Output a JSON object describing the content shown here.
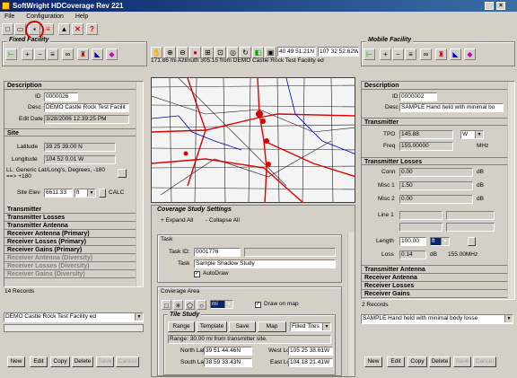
{
  "window": {
    "title": "SoftWright HDCoverage Rev 221"
  },
  "menu": [
    "File",
    "Configuration",
    "Help"
  ],
  "fixed": {
    "group_label": "Fixed Facility",
    "description_head": "Description",
    "id_label": "ID",
    "id_value": "0000026",
    "desc_label": "Desc",
    "desc_value": "DEMO Castle Rock Test Facilit",
    "edit_label": "Edit Date",
    "edit_value": "3/28/2006 12:39:25 PM",
    "site_head": "Site",
    "lat_label": "Latitude",
    "lat_value": "39 25 39.00 N",
    "lon_label": "Longitude",
    "lon_value": "104 52 0.01 W",
    "ll_note": "LL: Generic Lat/Long's, Degrees, -180 ==> +180",
    "elev_label": "Site Elev",
    "elev_value": "6611.33",
    "elev_unit": "ft",
    "calc": "CALC",
    "sections": [
      {
        "label": "Transmitter",
        "dim": false
      },
      {
        "label": "Transmitter Losses",
        "dim": false
      },
      {
        "label": "Transmitter Antenna",
        "dim": false
      },
      {
        "label": "Receiver Antenna (Primary)",
        "dim": false
      },
      {
        "label": "Receiver Losses (Primary)",
        "dim": false
      },
      {
        "label": "Receiver Gains (Primary)",
        "dim": false
      },
      {
        "label": "Receiver Antenna (Diversity)",
        "dim": true
      },
      {
        "label": "Receiver Losses (Diversity)",
        "dim": true
      },
      {
        "label": "Receiver Gains (Diversity)",
        "dim": true
      }
    ],
    "records": "14 Records",
    "select_value": "DEMO Castle Rock Test Facility ed",
    "buttons": [
      "New",
      "Edit",
      "Copy",
      "Delete",
      "Save",
      "Cancel"
    ]
  },
  "map": {
    "coord_lat": "40 49 51.21N",
    "coord_lon": "107 32 52.62W",
    "status": "171.86 mi Azimuth 305.15 from DEMO Castle Rock Test Facility ed"
  },
  "study": {
    "title": "Coverage Study Settings",
    "expand": "+ Expand All",
    "collapse": "- Collapse All",
    "task_head": "Task",
    "task_id_label": "Task ID:",
    "task_id_value": "0001776",
    "task_label": "Task",
    "task_value": "Sample Shadow Study",
    "autodraw": "AutoDraw",
    "area_head": "Coverage Area",
    "area_unit": "mi",
    "draw_on_map": "Draw on map",
    "tile_head": "Tile Study",
    "tile_buttons": [
      "Range",
      "Template",
      "Save",
      "Map"
    ],
    "tile_select": "Filled Tiles",
    "range_text": "Range: 30.00 mi from transmitter site.",
    "north_label": "North Lat",
    "north_value": "39 51 44.46N",
    "west_label": "West Lon",
    "west_value": "105 25 38.61W",
    "south_label": "South Lat",
    "south_value": "38 59 33.43N",
    "east_label": "East Lon",
    "east_value": "104 18 21.41W"
  },
  "mobile": {
    "group_label": "Mobile Facility",
    "description_head": "Description",
    "id_label": "ID",
    "id_value": "0000002",
    "desc_label": "Desc",
    "desc_value": "SAMPLE Hand held with minimal bo",
    "tx_head": "Transmitter",
    "tpo_label": "TPO",
    "tpo_value": "145.88",
    "tpo_unit": "W",
    "freq_label": "Freq",
    "freq_value": "155.00000",
    "freq_unit": "MHz",
    "txl_head": "Transmitter Losses",
    "conn_label": "Conn",
    "conn_value": "0.00",
    "db": "dB",
    "misc1_label": "Misc 1",
    "misc1_value": "1.50",
    "misc2_label": "Misc 2",
    "misc2_value": "0.00",
    "line1_label": "Line 1",
    "length_label": "Length",
    "length_value": "100.00",
    "length_unit": "ft",
    "loss_label": "Loss",
    "loss_value": "0.14",
    "loss_db": "dB",
    "loss_freq": "155.00MHz",
    "sections": [
      "Transmitter Antenna",
      "Receiver Antenna",
      "Receiver Losses",
      "Receiver Gains"
    ],
    "records": "2 Records",
    "select_value": "SAMPLE Hand held with minimal body losse",
    "buttons": [
      "New",
      "Edit",
      "Copy",
      "Delete",
      "Save",
      "Cancel"
    ]
  }
}
